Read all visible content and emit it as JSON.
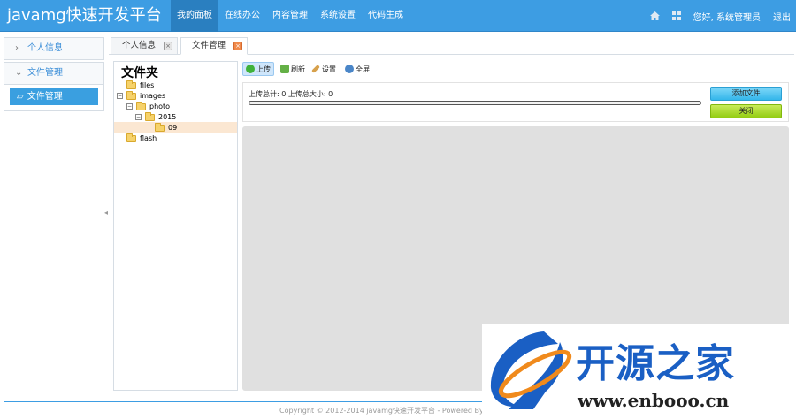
{
  "header": {
    "brand": "javamg快速开发平台",
    "nav": [
      {
        "label": "我的面板",
        "active": true
      },
      {
        "label": "在线办公",
        "active": false
      },
      {
        "label": "内容管理",
        "active": false
      },
      {
        "label": "系统设置",
        "active": false
      },
      {
        "label": "代码生成",
        "active": false
      }
    ],
    "home_icon": "home-icon",
    "grid_icon": "grid-icon",
    "greeting": "您好, 系统管理员",
    "logout": "退出"
  },
  "sidebar": {
    "sections": [
      {
        "label": "个人信息",
        "expanded": false
      },
      {
        "label": "文件管理",
        "expanded": true
      }
    ],
    "active_item": "文件管理"
  },
  "tabs": [
    {
      "label": "个人信息",
      "active": false
    },
    {
      "label": "文件管理",
      "active": true
    }
  ],
  "tree": {
    "title": "文件夹",
    "nodes": [
      {
        "label": "files"
      },
      {
        "label": "images"
      },
      {
        "label": "photo"
      },
      {
        "label": "2015"
      },
      {
        "label": "09",
        "selected": true
      },
      {
        "label": "flash"
      }
    ]
  },
  "toolbar": {
    "upload": "上传",
    "refresh": "刷新",
    "settings": "设置",
    "fullscreen": "全屏"
  },
  "upload_panel": {
    "info": "上传总计: 0 上传总大小: 0",
    "progress": 0,
    "add_file": "添加文件",
    "close": "关闭"
  },
  "footer": {
    "copyright": "Copyright © 2012-2014 javamg快速开发平台 - Powered By HuaYin"
  },
  "watermark": {
    "text": "开源之家",
    "url": "www.enbooo.cn"
  },
  "colors": {
    "header_bg": "#3d9de3",
    "accent": "#3a9fe0",
    "selected_row": "#fbe7d2",
    "add_button": "#34b6eb",
    "close_button": "#93cc12"
  }
}
